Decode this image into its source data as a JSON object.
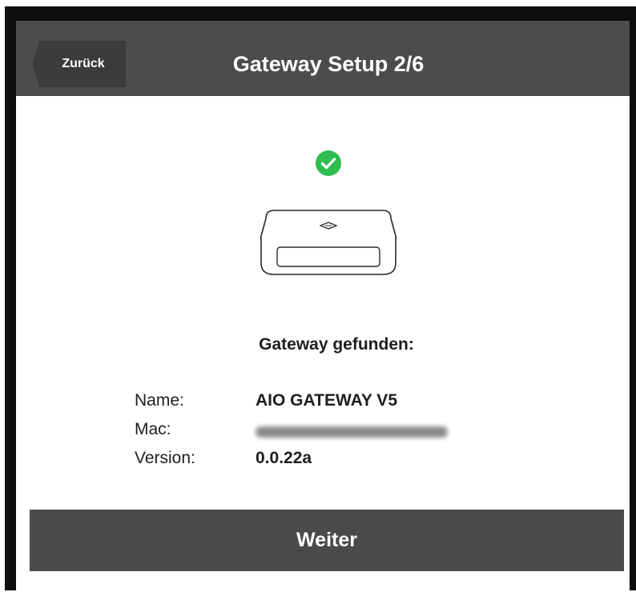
{
  "header": {
    "back_label": "Zurück",
    "title": "Gateway Setup 2/6",
    "background": "#4c4c4c"
  },
  "status": {
    "icon": "check-circle-icon",
    "color": "#2ebd4e"
  },
  "device": {
    "icon": "gateway-device-icon"
  },
  "found": {
    "heading": "Gateway gefunden:"
  },
  "info": {
    "name_label": "Name:",
    "name_value": "AIO GATEWAY V5",
    "mac_label": "Mac:",
    "mac_value_redacted": true,
    "version_label": "Version:",
    "version_value": "0.0.22a"
  },
  "footer": {
    "next_label": "Weiter"
  }
}
